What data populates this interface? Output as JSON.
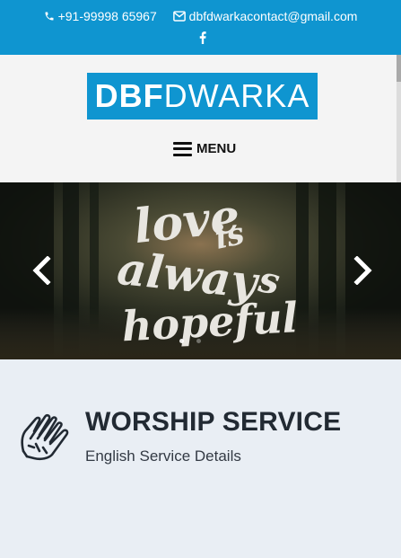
{
  "topbar": {
    "phone": "+91-99998 65967",
    "email": "dbfdwarkacontact@gmail.com",
    "icons": [
      "phone-icon",
      "envelope-icon",
      "facebook-icon"
    ]
  },
  "header": {
    "logo_bold": "DBF",
    "logo_light": "DWARKA",
    "menu_label": "MENU"
  },
  "hero": {
    "slide_text": [
      "love",
      "is",
      "always",
      "hopeful"
    ],
    "active_slide": 1,
    "slide_count": 2
  },
  "section": {
    "title": "WORSHIP SERVICE",
    "subtitle": "English Service Details",
    "icon": "praying-hands-icon"
  },
  "colors": {
    "brand": "#0f95d0",
    "header_bg": "#f4f4f4",
    "section_bg": "#e9eef4",
    "title": "#222a33"
  }
}
